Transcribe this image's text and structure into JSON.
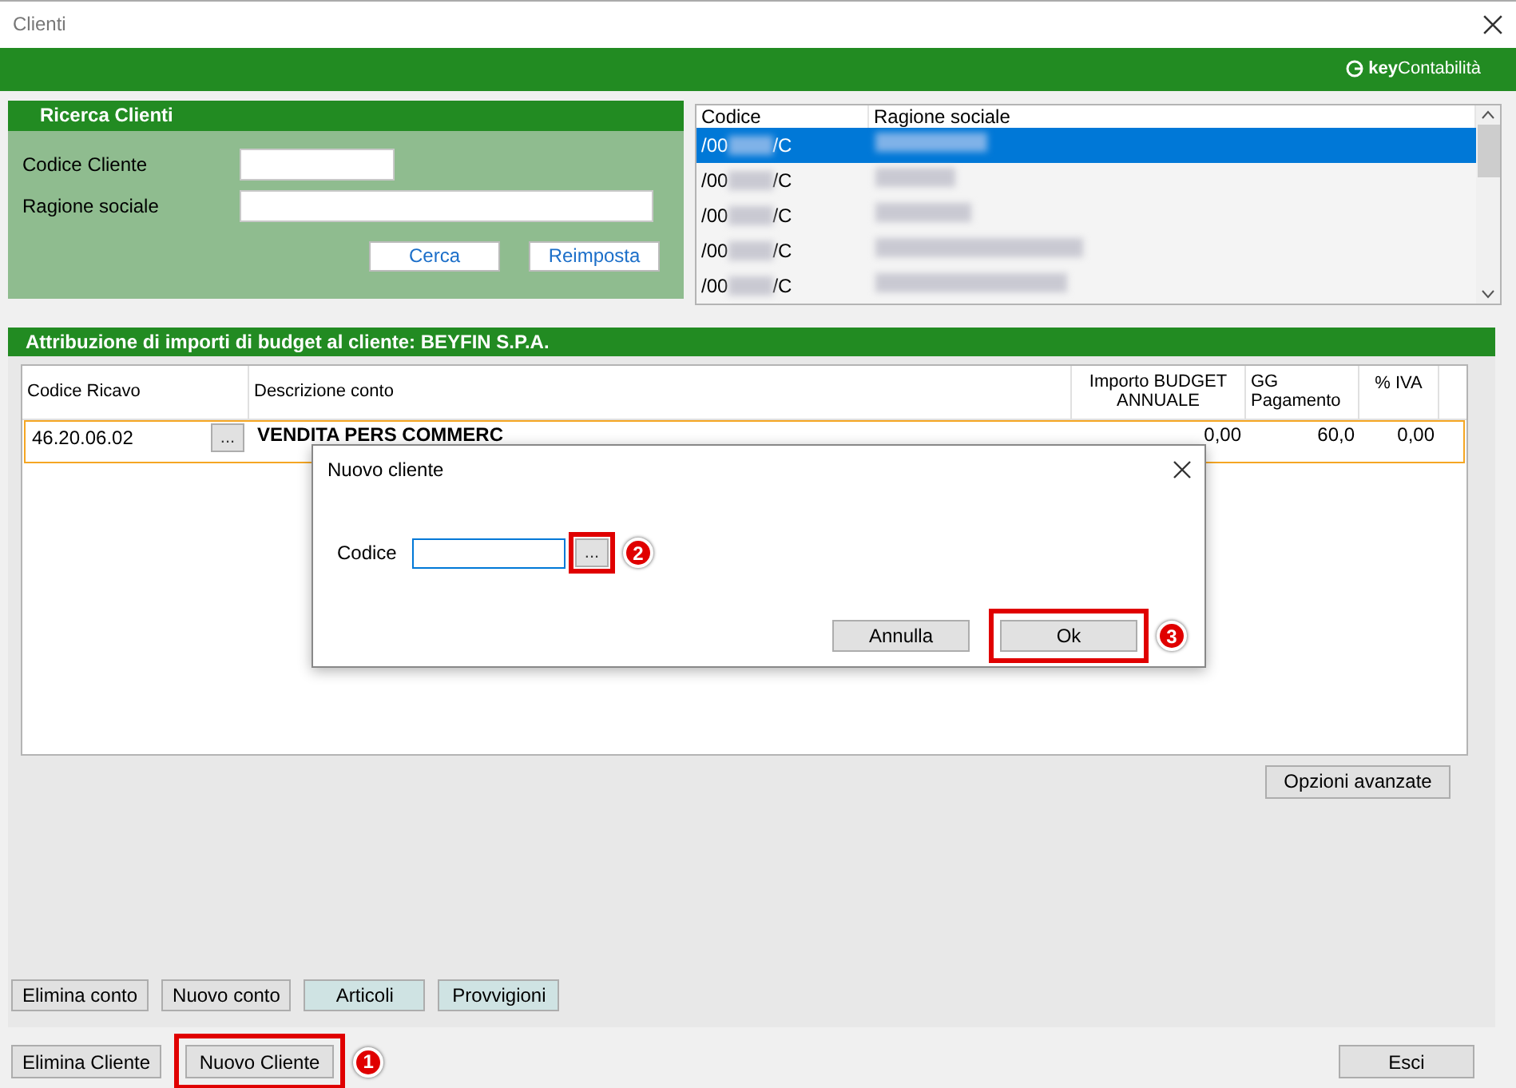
{
  "window": {
    "title": "Clienti"
  },
  "brand": {
    "bold": "key",
    "rest": "Contabilità"
  },
  "search_panel": {
    "title": "Ricerca Clienti",
    "fields": [
      {
        "label": "Codice Cliente",
        "kind": "short"
      },
      {
        "label": "Ragione sociale",
        "kind": "long"
      }
    ],
    "buttons": [
      "Cerca",
      "Reimposta"
    ]
  },
  "client_list": {
    "columns": [
      "Codice",
      "Ragione sociale"
    ],
    "rows": [
      {
        "code_start": "/00",
        "code_end": "/C",
        "selected": true
      },
      {
        "code_start": "/00",
        "code_end": "/C",
        "selected": false
      },
      {
        "code_start": "/00",
        "code_end": "/C",
        "selected": false
      },
      {
        "code_start": "/00",
        "code_end": "/C",
        "selected": false
      },
      {
        "code_start": "/00",
        "code_end": "/C",
        "selected": false
      }
    ]
  },
  "budget_section": {
    "title": "Attribuzione di importi di budget al cliente: BEYFIN S.P.A.",
    "columns": [
      "Codice Ricavo",
      "Descrizione conto",
      "Importo BUDGET ANNUALE",
      "GG Pagamento",
      "% IVA"
    ],
    "rows": [
      {
        "codice": "46.20.06.02",
        "browse": "...",
        "descrizione": "VENDITA PERS COMMERC",
        "importo": "0,00",
        "gg": "60,0",
        "iva": "0,00",
        "selected": true
      }
    ]
  },
  "advanced_button": "Opzioni avanzate",
  "account_buttons": [
    {
      "label": "Elimina conto",
      "kind": "plain"
    },
    {
      "label": "Nuovo conto",
      "kind": "plain"
    },
    {
      "label": "Articoli",
      "kind": "tinted"
    },
    {
      "label": "Provvigioni",
      "kind": "tinted"
    }
  ],
  "footer_buttons": [
    {
      "label": "Elimina Cliente"
    },
    {
      "label": "Nuovo Cliente",
      "callout": "1"
    }
  ],
  "exit_button": "Esci",
  "dialog": {
    "title": "Nuovo cliente",
    "field_label": "Codice",
    "browse": {
      "label": "...",
      "callout": "2"
    },
    "buttons": [
      {
        "label": "Annulla"
      },
      {
        "label": "Ok",
        "callout": "3"
      }
    ]
  }
}
